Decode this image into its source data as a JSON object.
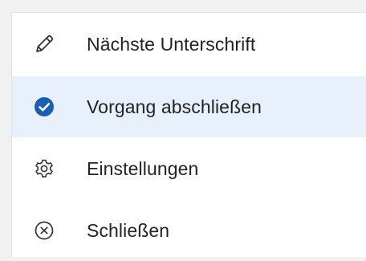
{
  "menu": {
    "items": [
      {
        "label": "Nächste Unterschrift",
        "icon": "pencil-icon",
        "selected": false
      },
      {
        "label": "Vorgang abschließen",
        "icon": "check-circle-icon",
        "selected": true
      },
      {
        "label": "Einstellungen",
        "icon": "gear-icon",
        "selected": false
      },
      {
        "label": "Schließen",
        "icon": "close-circle-icon",
        "selected": false
      }
    ]
  },
  "colors": {
    "accent": "#1a5fb4",
    "selected_background": "#e8f1fb",
    "text": "#222222",
    "icon": "#333333"
  }
}
